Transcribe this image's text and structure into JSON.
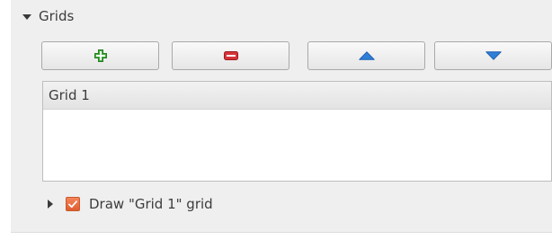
{
  "section": {
    "title": "Grids"
  },
  "toolbar": {
    "add_icon": "plus-icon",
    "remove_icon": "minus-icon",
    "up_icon": "arrow-up-icon",
    "down_icon": "arrow-down-icon"
  },
  "grid_list": {
    "items": [
      {
        "label": "Grid 1"
      }
    ]
  },
  "draw_grid": {
    "label": "Draw \"Grid 1\" grid",
    "checked": true
  },
  "colors": {
    "add_green": "#3fae3a",
    "remove_red": "#d6333a",
    "arrow_blue": "#2f7fd8",
    "checkbox_orange": "#e86a3b"
  }
}
